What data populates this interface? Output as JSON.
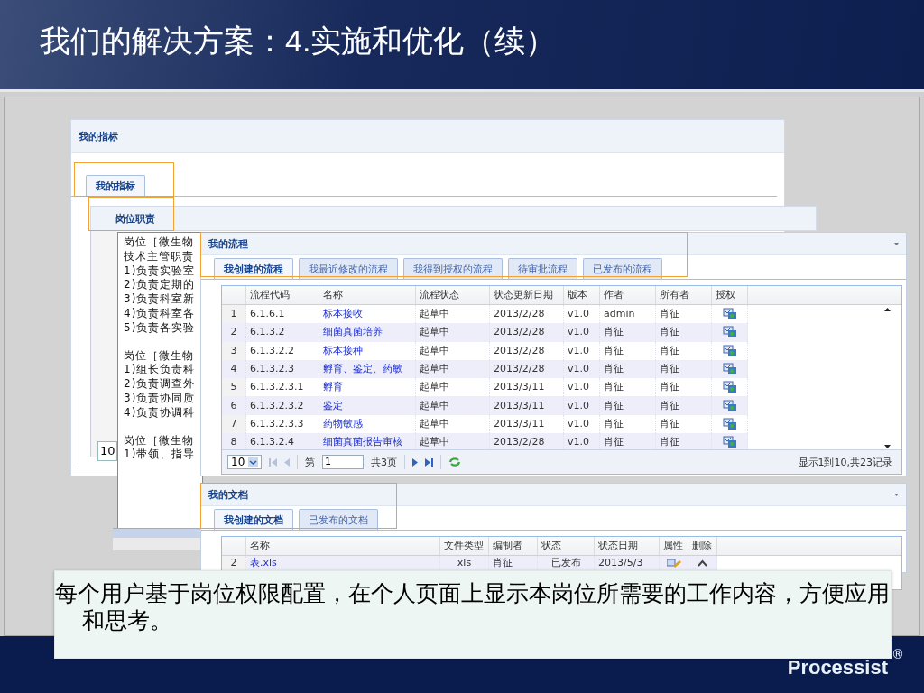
{
  "slide_title": "我们的解决方案：4.实施和优化（续）",
  "indicator_panel": {
    "title": "我的指标",
    "tabs": [
      {
        "label": "我的指标",
        "selected": true
      }
    ],
    "sub_panel_title": "岗位职责",
    "page_size": "10"
  },
  "duty_text": {
    "paragraphs": [
      [
        "岗位［微生物",
        "技术主管职责",
        "1)负责实验室",
        "2)负责定期的",
        "3)负责科室新",
        "4)负责科室各",
        "5)负责各实验"
      ],
      [
        "岗位［微生物",
        "1)组长负责科",
        "2)负责调查外",
        "3)负责协同质",
        "4)负责协调科"
      ],
      [
        "岗位［微生物",
        "1)带领、指导"
      ]
    ]
  },
  "flow_panel": {
    "title": "我的流程",
    "tabs": [
      {
        "label": "我创建的流程",
        "selected": true
      },
      {
        "label": "我最近修改的流程",
        "selected": false
      },
      {
        "label": "我得到授权的流程",
        "selected": false
      },
      {
        "label": "待审批流程",
        "selected": false
      },
      {
        "label": "已发布的流程",
        "selected": false
      }
    ],
    "columns": [
      {
        "label": "流程代码",
        "kind": "text"
      },
      {
        "label": "名称",
        "kind": "link"
      },
      {
        "label": "流程状态",
        "kind": "text"
      },
      {
        "label": "状态更新日期",
        "kind": "text"
      },
      {
        "label": "版本",
        "kind": "text"
      },
      {
        "label": "作者",
        "kind": "text"
      },
      {
        "label": "所有者",
        "kind": "text"
      },
      {
        "label": "授权",
        "kind": "authorize"
      }
    ],
    "rows": [
      {
        "index": "1",
        "cells": [
          "6.1.6.1",
          "标本接收",
          "起草中",
          "2013/2/28",
          "v1.0",
          "admin",
          "肖征"
        ]
      },
      {
        "index": "2",
        "cells": [
          "6.1.3.2",
          "细菌真菌培养",
          "起草中",
          "2013/2/28",
          "v1.0",
          "肖征",
          "肖征"
        ]
      },
      {
        "index": "3",
        "cells": [
          "6.1.3.2.2",
          "标本接种",
          "起草中",
          "2013/2/28",
          "v1.0",
          "肖征",
          "肖征"
        ]
      },
      {
        "index": "4",
        "cells": [
          "6.1.3.2.3",
          "孵育、鉴定、药敏",
          "起草中",
          "2013/2/28",
          "v1.0",
          "肖征",
          "肖征"
        ]
      },
      {
        "index": "5",
        "cells": [
          "6.1.3.2.3.1",
          "孵育",
          "起草中",
          "2013/3/11",
          "v1.0",
          "肖征",
          "肖征"
        ]
      },
      {
        "index": "6",
        "cells": [
          "6.1.3.2.3.2",
          "鉴定",
          "起草中",
          "2013/3/11",
          "v1.0",
          "肖征",
          "肖征"
        ]
      },
      {
        "index": "7",
        "cells": [
          "6.1.3.2.3.3",
          "药物敏感",
          "起草中",
          "2013/3/11",
          "v1.0",
          "肖征",
          "肖征"
        ]
      },
      {
        "index": "8",
        "cells": [
          "6.1.3.2.4",
          "细菌真菌报告审核",
          "起草中",
          "2013/2/28",
          "v1.0",
          "肖征",
          "肖征"
        ]
      }
    ],
    "pager": {
      "page_size": "10",
      "page_label": "第",
      "page": "1",
      "total_pages": "共3页",
      "summary": "显示1到10,共23记录"
    }
  },
  "doc_panel": {
    "title": "我的文档",
    "tabs": [
      {
        "label": "我创建的文档",
        "selected": true
      },
      {
        "label": "已发布的文档",
        "selected": false
      }
    ],
    "columns": [
      {
        "label": "名称",
        "kind": "link"
      },
      {
        "label": "文件类型",
        "kind": "center"
      },
      {
        "label": "编制者",
        "kind": "text"
      },
      {
        "label": "状态",
        "kind": "center"
      },
      {
        "label": "状态日期",
        "kind": "text"
      },
      {
        "label": "属性",
        "kind": "edit"
      },
      {
        "label": "删除",
        "kind": "remove"
      }
    ],
    "rows": [
      {
        "index": "2",
        "cells": [
          "表.xls",
          "xls",
          "肖征",
          "已发布",
          "2013/5/3"
        ]
      }
    ]
  },
  "caption": "每个用户基于岗位权限配置，在个人页面上显示本岗位所需要的工作内容，方便应用和思考。",
  "logo": {
    "name": "Processist",
    "mark": "®"
  }
}
